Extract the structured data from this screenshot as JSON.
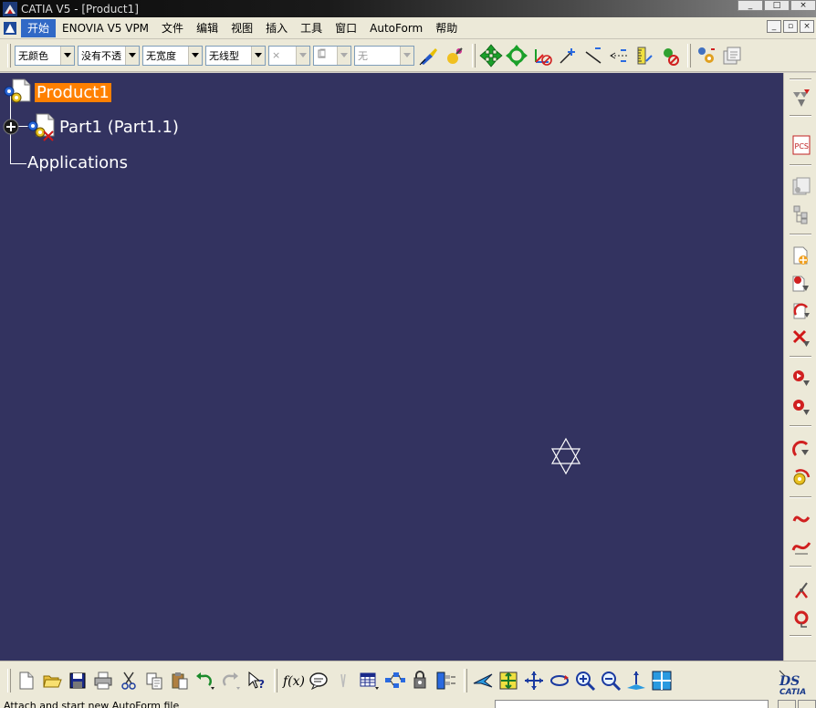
{
  "window": {
    "title": "CATIA V5 - [Product1]"
  },
  "menu": {
    "items": [
      "开始",
      "ENOVIA V5 VPM",
      "文件",
      "编辑",
      "视图",
      "插入",
      "工具",
      "窗口",
      "AutoForm",
      "帮助"
    ],
    "active_index": 0
  },
  "graphic_properties": {
    "color": "无颜色",
    "transparency": "没有不透",
    "line_width": "无宽度",
    "line_type": "无线型",
    "point_symbol": "×",
    "layer_icon": "layer-icon",
    "layer": "无"
  },
  "tree": {
    "root": "Product1",
    "child": "Part1 (Part1.1)",
    "applications": "Applications"
  },
  "status": {
    "text": "Attach and start new AutoForm file"
  },
  "colors": {
    "canvas": "#333360",
    "selection": "#ff8000",
    "toolbar": "#ece9d8",
    "menu_active": "#3169c6"
  },
  "top_toolbar_icons": [
    "paint-brush-icon",
    "painter-icon",
    "pan-icon",
    "rotate-icon",
    "axis-toggle-icon",
    "point-icon",
    "line-icon",
    "swap-icon",
    "measure-icon",
    "hide-show-icon",
    "options-icon",
    "properties-icon"
  ],
  "right_toolbar_icons": [
    "filter-icon",
    "pcs-icon",
    "parts-catalog-icon",
    "tree-icon",
    "new-component-icon",
    "existing-component-icon",
    "replace-component-icon",
    "delete-icon",
    "constraint-icon",
    "fix-icon",
    "manipulate-icon",
    "snap-icon",
    "explode-icon",
    "clash-icon",
    "fix-together-icon",
    "reorder-icon"
  ],
  "bottom_toolbar_icons": [
    "new-icon",
    "open-icon",
    "save-icon",
    "print-icon",
    "cut-icon",
    "copy-icon",
    "paste-icon",
    "undo-icon",
    "redo-icon",
    "whats-this-icon",
    "formula-icon",
    "comment-icon",
    "macro-icon",
    "table-icon",
    "graph-tree-icon",
    "knowledge-icon",
    "catalog-icon",
    "fly-mode-icon",
    "fit-all-icon",
    "pan-icon",
    "rotate-view-icon",
    "zoom-in-icon",
    "zoom-out-icon",
    "normal-view-icon",
    "multi-view-icon",
    "3ds-logo-icon"
  ]
}
